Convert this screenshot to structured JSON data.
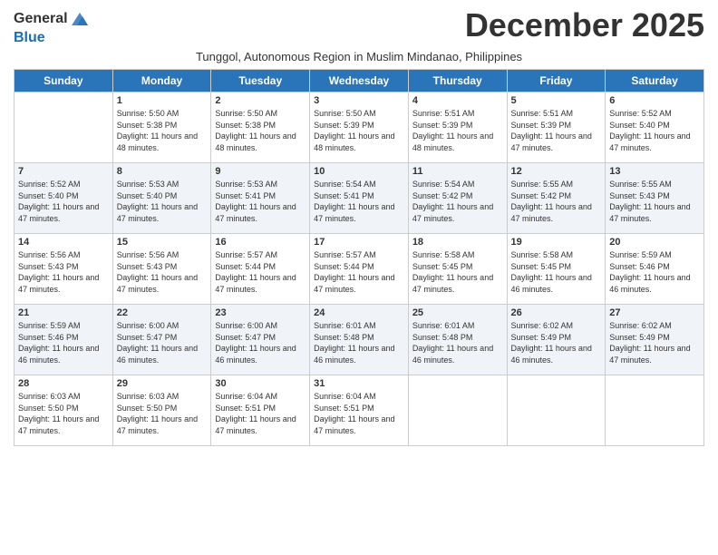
{
  "header": {
    "logo_general": "General",
    "logo_blue": "Blue",
    "month_title": "December 2025",
    "subtitle": "Tunggol, Autonomous Region in Muslim Mindanao, Philippines"
  },
  "days_of_week": [
    "Sunday",
    "Monday",
    "Tuesday",
    "Wednesday",
    "Thursday",
    "Friday",
    "Saturday"
  ],
  "weeks": [
    [
      {
        "day": "",
        "sunrise": "",
        "sunset": "",
        "daylight": ""
      },
      {
        "day": "1",
        "sunrise": "Sunrise: 5:50 AM",
        "sunset": "Sunset: 5:38 PM",
        "daylight": "Daylight: 11 hours and 48 minutes."
      },
      {
        "day": "2",
        "sunrise": "Sunrise: 5:50 AM",
        "sunset": "Sunset: 5:38 PM",
        "daylight": "Daylight: 11 hours and 48 minutes."
      },
      {
        "day": "3",
        "sunrise": "Sunrise: 5:50 AM",
        "sunset": "Sunset: 5:39 PM",
        "daylight": "Daylight: 11 hours and 48 minutes."
      },
      {
        "day": "4",
        "sunrise": "Sunrise: 5:51 AM",
        "sunset": "Sunset: 5:39 PM",
        "daylight": "Daylight: 11 hours and 48 minutes."
      },
      {
        "day": "5",
        "sunrise": "Sunrise: 5:51 AM",
        "sunset": "Sunset: 5:39 PM",
        "daylight": "Daylight: 11 hours and 47 minutes."
      },
      {
        "day": "6",
        "sunrise": "Sunrise: 5:52 AM",
        "sunset": "Sunset: 5:40 PM",
        "daylight": "Daylight: 11 hours and 47 minutes."
      }
    ],
    [
      {
        "day": "7",
        "sunrise": "Sunrise: 5:52 AM",
        "sunset": "Sunset: 5:40 PM",
        "daylight": "Daylight: 11 hours and 47 minutes."
      },
      {
        "day": "8",
        "sunrise": "Sunrise: 5:53 AM",
        "sunset": "Sunset: 5:40 PM",
        "daylight": "Daylight: 11 hours and 47 minutes."
      },
      {
        "day": "9",
        "sunrise": "Sunrise: 5:53 AM",
        "sunset": "Sunset: 5:41 PM",
        "daylight": "Daylight: 11 hours and 47 minutes."
      },
      {
        "day": "10",
        "sunrise": "Sunrise: 5:54 AM",
        "sunset": "Sunset: 5:41 PM",
        "daylight": "Daylight: 11 hours and 47 minutes."
      },
      {
        "day": "11",
        "sunrise": "Sunrise: 5:54 AM",
        "sunset": "Sunset: 5:42 PM",
        "daylight": "Daylight: 11 hours and 47 minutes."
      },
      {
        "day": "12",
        "sunrise": "Sunrise: 5:55 AM",
        "sunset": "Sunset: 5:42 PM",
        "daylight": "Daylight: 11 hours and 47 minutes."
      },
      {
        "day": "13",
        "sunrise": "Sunrise: 5:55 AM",
        "sunset": "Sunset: 5:43 PM",
        "daylight": "Daylight: 11 hours and 47 minutes."
      }
    ],
    [
      {
        "day": "14",
        "sunrise": "Sunrise: 5:56 AM",
        "sunset": "Sunset: 5:43 PM",
        "daylight": "Daylight: 11 hours and 47 minutes."
      },
      {
        "day": "15",
        "sunrise": "Sunrise: 5:56 AM",
        "sunset": "Sunset: 5:43 PM",
        "daylight": "Daylight: 11 hours and 47 minutes."
      },
      {
        "day": "16",
        "sunrise": "Sunrise: 5:57 AM",
        "sunset": "Sunset: 5:44 PM",
        "daylight": "Daylight: 11 hours and 47 minutes."
      },
      {
        "day": "17",
        "sunrise": "Sunrise: 5:57 AM",
        "sunset": "Sunset: 5:44 PM",
        "daylight": "Daylight: 11 hours and 47 minutes."
      },
      {
        "day": "18",
        "sunrise": "Sunrise: 5:58 AM",
        "sunset": "Sunset: 5:45 PM",
        "daylight": "Daylight: 11 hours and 47 minutes."
      },
      {
        "day": "19",
        "sunrise": "Sunrise: 5:58 AM",
        "sunset": "Sunset: 5:45 PM",
        "daylight": "Daylight: 11 hours and 46 minutes."
      },
      {
        "day": "20",
        "sunrise": "Sunrise: 5:59 AM",
        "sunset": "Sunset: 5:46 PM",
        "daylight": "Daylight: 11 hours and 46 minutes."
      }
    ],
    [
      {
        "day": "21",
        "sunrise": "Sunrise: 5:59 AM",
        "sunset": "Sunset: 5:46 PM",
        "daylight": "Daylight: 11 hours and 46 minutes."
      },
      {
        "day": "22",
        "sunrise": "Sunrise: 6:00 AM",
        "sunset": "Sunset: 5:47 PM",
        "daylight": "Daylight: 11 hours and 46 minutes."
      },
      {
        "day": "23",
        "sunrise": "Sunrise: 6:00 AM",
        "sunset": "Sunset: 5:47 PM",
        "daylight": "Daylight: 11 hours and 46 minutes."
      },
      {
        "day": "24",
        "sunrise": "Sunrise: 6:01 AM",
        "sunset": "Sunset: 5:48 PM",
        "daylight": "Daylight: 11 hours and 46 minutes."
      },
      {
        "day": "25",
        "sunrise": "Sunrise: 6:01 AM",
        "sunset": "Sunset: 5:48 PM",
        "daylight": "Daylight: 11 hours and 46 minutes."
      },
      {
        "day": "26",
        "sunrise": "Sunrise: 6:02 AM",
        "sunset": "Sunset: 5:49 PM",
        "daylight": "Daylight: 11 hours and 46 minutes."
      },
      {
        "day": "27",
        "sunrise": "Sunrise: 6:02 AM",
        "sunset": "Sunset: 5:49 PM",
        "daylight": "Daylight: 11 hours and 47 minutes."
      }
    ],
    [
      {
        "day": "28",
        "sunrise": "Sunrise: 6:03 AM",
        "sunset": "Sunset: 5:50 PM",
        "daylight": "Daylight: 11 hours and 47 minutes."
      },
      {
        "day": "29",
        "sunrise": "Sunrise: 6:03 AM",
        "sunset": "Sunset: 5:50 PM",
        "daylight": "Daylight: 11 hours and 47 minutes."
      },
      {
        "day": "30",
        "sunrise": "Sunrise: 6:04 AM",
        "sunset": "Sunset: 5:51 PM",
        "daylight": "Daylight: 11 hours and 47 minutes."
      },
      {
        "day": "31",
        "sunrise": "Sunrise: 6:04 AM",
        "sunset": "Sunset: 5:51 PM",
        "daylight": "Daylight: 11 hours and 47 minutes."
      },
      {
        "day": "",
        "sunrise": "",
        "sunset": "",
        "daylight": ""
      },
      {
        "day": "",
        "sunrise": "",
        "sunset": "",
        "daylight": ""
      },
      {
        "day": "",
        "sunrise": "",
        "sunset": "",
        "daylight": ""
      }
    ]
  ]
}
